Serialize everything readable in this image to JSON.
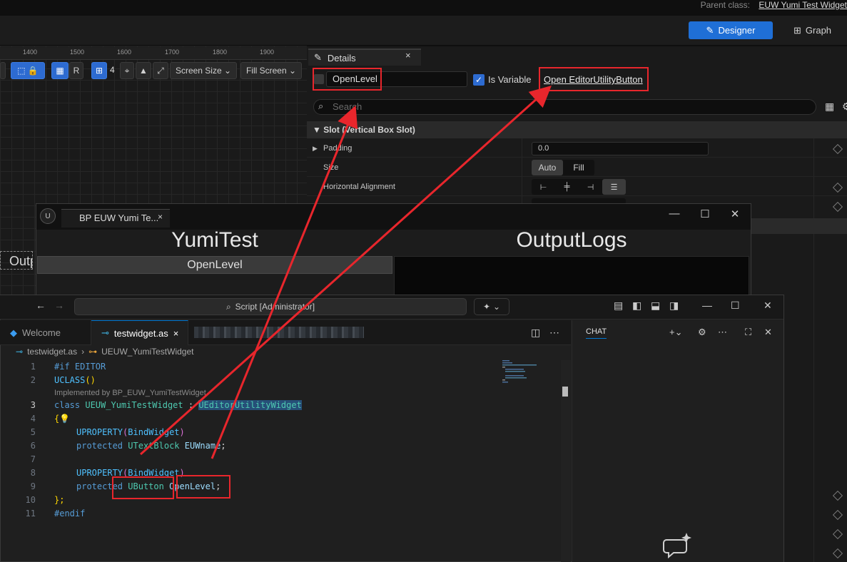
{
  "ue": {
    "parent_class_label": "Parent class:",
    "parent_class_value": "EUW Yumi Test Widget",
    "designer_label": "Designer",
    "graph_label": "Graph",
    "ruler": [
      "1400",
      "1500",
      "1600",
      "1700",
      "1800",
      "1900"
    ],
    "toolbar": {
      "R": "R",
      "zoom": "4",
      "screen_size": "Screen Size",
      "fill_screen": "Fill Screen"
    },
    "details": {
      "tab_label": "Details",
      "close": "×",
      "name_value": "OpenLevel",
      "is_variable_label": "Is Variable",
      "open_link": "Open EditorUtilityButton",
      "search_placeholder": "Search",
      "slot_header": "Slot (Vertical Box Slot)",
      "padding_label": "Padding",
      "padding_value": "0.0",
      "size_label": "Size",
      "size_auto": "Auto",
      "size_fill": "Fill",
      "halign_label": "Horizontal Alignment"
    }
  },
  "uew_window": {
    "tab_label": "BP EUW Yumi Te...",
    "tab_close": "×",
    "yumitest_title": "YumiTest",
    "outputlogs_title": "OutputLogs",
    "openlevel_button": "OpenLevel",
    "canvas_fragment": "Outp"
  },
  "vscode": {
    "search_label": "Script [Administrator]",
    "tabs": [
      {
        "label": "Welcome"
      },
      {
        "label": "testwidget.as",
        "close": "×"
      }
    ],
    "breadcrumb_file": "testwidget.as",
    "breadcrumb_symbol": "UEUW_YumiTestWidget",
    "codelens": "Implemented by BP_EUW_YumiTestWidget",
    "line_numbers": [
      "1",
      "2",
      "3",
      "4",
      "5",
      "6",
      "7",
      "8",
      "9",
      "10",
      "11"
    ],
    "code": {
      "l1": "#if EDITOR",
      "l2_a": "UCLASS",
      "l2_b": "()",
      "l3_kw": "class",
      "l3_name": "UEUW_YumiTestWidget",
      "l3_colon": " : ",
      "l3_base": "UEditorUtilityWidget",
      "l4": "{",
      "l5_a": "UPROPERTY",
      "l5_b": "(",
      "l5_c": "BindWidget",
      "l5_d": ")",
      "l6_kw": "protected",
      "l6_type": "UTextBlock",
      "l6_var": "EUWname",
      "l6_end": ";",
      "l8_a": "UPROPERTY",
      "l8_b": "(",
      "l8_c": "BindWidget",
      "l8_d": ")",
      "l9_kw": "protected",
      "l9_type": "UButton",
      "l9_var": "OpenLevel",
      "l9_end": ";",
      "l10": "};",
      "l11": "#endif"
    },
    "chat_label": "CHAT"
  },
  "colors": {
    "accent_blue": "#1f6fd6",
    "annotation_red": "#e8262c",
    "vs_tab_active": "#0078d4"
  }
}
